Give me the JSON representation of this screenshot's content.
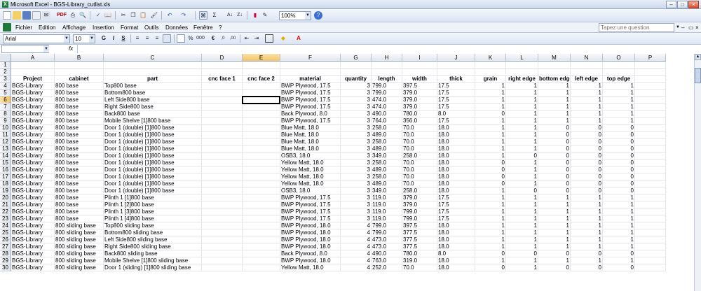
{
  "window": {
    "title": "Microsoft Excel - BGS-Library_cutlist.xls",
    "app_icon": "X"
  },
  "toolbar": {
    "zoom": "100%",
    "pdf_label": "PDF"
  },
  "menu": {
    "items": [
      "Fichier",
      "Edition",
      "Affichage",
      "Insertion",
      "Format",
      "Outils",
      "Données",
      "Fenêtre",
      "?"
    ],
    "help_placeholder": "Tapez une question"
  },
  "format_bar": {
    "font": "Arial",
    "size": "10",
    "bold": "G",
    "italic": "I",
    "underline": "S"
  },
  "formula_bar": {
    "name_box": "",
    "fx": "fx",
    "value": ""
  },
  "sheet": {
    "columns": [
      "A",
      "B",
      "C",
      "D",
      "E",
      "F",
      "G",
      "H",
      "I",
      "J",
      "K",
      "L",
      "M",
      "N",
      "O",
      "P"
    ],
    "selected_column": "E",
    "selected_row": "6",
    "headers": [
      "Project",
      "cabinet",
      "part",
      "cnc face 1",
      "cnc face 2",
      "material",
      "quantity",
      "length",
      "width",
      "thick",
      "grain",
      "right edge",
      "bottom edge",
      "left edge",
      "top edge",
      ""
    ],
    "rows": [
      [
        "BGS-Library",
        "800 base",
        "Top800 base",
        "",
        "",
        "BWP Plywood, 17.5",
        "3",
        "799.0",
        "397.5",
        "17.5",
        "1",
        "1",
        "1",
        "1",
        "1"
      ],
      [
        "BGS-Library",
        "800 base",
        "Bottom800 base",
        "",
        "",
        "BWP Plywood, 17.5",
        "3",
        "799.0",
        "379.0",
        "17.5",
        "1",
        "1",
        "1",
        "1",
        "1"
      ],
      [
        "BGS-Library",
        "800 base",
        "Left Side800 base",
        "",
        "",
        "BWP Plywood, 17.5",
        "3",
        "474.0",
        "379.0",
        "17.5",
        "1",
        "1",
        "1",
        "1",
        "1"
      ],
      [
        "BGS-Library",
        "800 base",
        "Right Side800 base",
        "",
        "",
        "BWP Plywood, 17.5",
        "3",
        "474.0",
        "379.0",
        "17.5",
        "1",
        "1",
        "1",
        "1",
        "1"
      ],
      [
        "BGS-Library",
        "800 base",
        "Back800 base",
        "",
        "",
        "Back Plywood, 8.0",
        "3",
        "490.0",
        "780.0",
        "8.0",
        "0",
        "1",
        "1",
        "1",
        "1"
      ],
      [
        "BGS-Library",
        "800 base",
        "Mobile Shelve [1]800 base",
        "",
        "",
        "BWP Plywood, 17.5",
        "3",
        "764.0",
        "356.0",
        "17.5",
        "1",
        "1",
        "1",
        "1",
        "1"
      ],
      [
        "BGS-Library",
        "800 base",
        "Door 1 (double) [1]800 base",
        "",
        "",
        "Blue Matt, 18.0",
        "3",
        "258.0",
        "70.0",
        "18.0",
        "1",
        "1",
        "0",
        "0",
        "0"
      ],
      [
        "BGS-Library",
        "800 base",
        "Door 1 (double) [1]800 base",
        "",
        "",
        "Blue Matt, 18.0",
        "3",
        "489.0",
        "70.0",
        "18.0",
        "1",
        "1",
        "0",
        "0",
        "0"
      ],
      [
        "BGS-Library",
        "800 base",
        "Door 1 (double) [1]800 base",
        "",
        "",
        "Blue Matt, 18.0",
        "3",
        "258.0",
        "70.0",
        "18.0",
        "1",
        "1",
        "0",
        "0",
        "0"
      ],
      [
        "BGS-Library",
        "800 base",
        "Door 1 (double) [1]800 base",
        "",
        "",
        "Blue Matt, 18.0",
        "3",
        "489.0",
        "70.0",
        "18.0",
        "1",
        "1",
        "0",
        "0",
        "0"
      ],
      [
        "BGS-Library",
        "800 base",
        "Door 1 (double) [1]800 base",
        "",
        "",
        "OSB3, 18.0",
        "3",
        "349.0",
        "258.0",
        "18.0",
        "1",
        "0",
        "0",
        "0",
        "0"
      ],
      [
        "BGS-Library",
        "800 base",
        "Door 1 (double) [1]800 base",
        "",
        "",
        "Yellow Matt, 18.0",
        "3",
        "258.0",
        "70.0",
        "18.0",
        "0",
        "1",
        "0",
        "0",
        "0"
      ],
      [
        "BGS-Library",
        "800 base",
        "Door 1 (double) [1]800 base",
        "",
        "",
        "Yellow Matt, 18.0",
        "3",
        "489.0",
        "70.0",
        "18.0",
        "0",
        "1",
        "0",
        "0",
        "0"
      ],
      [
        "BGS-Library",
        "800 base",
        "Door 1 (double) [1]800 base",
        "",
        "",
        "Yellow Matt, 18.0",
        "3",
        "258.0",
        "70.0",
        "18.0",
        "0",
        "1",
        "0",
        "0",
        "0"
      ],
      [
        "BGS-Library",
        "800 base",
        "Door 1 (double) [1]800 base",
        "",
        "",
        "Yellow Matt, 18.0",
        "3",
        "489.0",
        "70.0",
        "18.0",
        "0",
        "1",
        "0",
        "0",
        "0"
      ],
      [
        "BGS-Library",
        "800 base",
        "Door 1 (double) [1]800 base",
        "",
        "",
        "OSB3, 18.0",
        "3",
        "349.0",
        "258.0",
        "18.0",
        "1",
        "0",
        "0",
        "0",
        "0"
      ],
      [
        "BGS-Library",
        "800 base",
        "Plinth 1 [1]800 base",
        "",
        "",
        "BWP Plywood, 17.5",
        "3",
        "119.0",
        "379.0",
        "17.5",
        "1",
        "1",
        "1",
        "1",
        "1"
      ],
      [
        "BGS-Library",
        "800 base",
        "Plinth 1 [2]800 base",
        "",
        "",
        "BWP Plywood, 17.5",
        "3",
        "119.0",
        "379.0",
        "17.5",
        "1",
        "1",
        "1",
        "1",
        "1"
      ],
      [
        "BGS-Library",
        "800 base",
        "Plinth 1 [3]800 base",
        "",
        "",
        "BWP Plywood, 17.5",
        "3",
        "119.0",
        "799.0",
        "17.5",
        "1",
        "1",
        "1",
        "1",
        "1"
      ],
      [
        "BGS-Library",
        "800 base",
        "Plinth 1 [4]800 base",
        "",
        "",
        "BWP Plywood, 17.5",
        "3",
        "119.0",
        "799.0",
        "17.5",
        "1",
        "1",
        "1",
        "1",
        "1"
      ],
      [
        "BGS-Library",
        "800 sliding base",
        "Top800 sliding base",
        "",
        "",
        "BWP Plywood, 18.0",
        "4",
        "799.0",
        "397.5",
        "18.0",
        "1",
        "1",
        "1",
        "1",
        "1"
      ],
      [
        "BGS-Library",
        "800 sliding base",
        "Bottom800 sliding base",
        "",
        "",
        "BWP Plywood, 18.0",
        "4",
        "799.0",
        "377.5",
        "18.0",
        "1",
        "1",
        "1",
        "1",
        "1"
      ],
      [
        "BGS-Library",
        "800 sliding base",
        "Left Side800 sliding base",
        "",
        "",
        "BWP Plywood, 18.0",
        "4",
        "473.0",
        "377.5",
        "18.0",
        "1",
        "1",
        "1",
        "1",
        "1"
      ],
      [
        "BGS-Library",
        "800 sliding base",
        "Right Side800 sliding base",
        "",
        "",
        "BWP Plywood, 18.0",
        "4",
        "473.0",
        "377.5",
        "18.0",
        "1",
        "1",
        "1",
        "1",
        "1"
      ],
      [
        "BGS-Library",
        "800 sliding base",
        "Back800 sliding base",
        "",
        "",
        "Back Plywood, 8.0",
        "4",
        "490.0",
        "780.0",
        "8.0",
        "0",
        "0",
        "0",
        "0",
        "0"
      ],
      [
        "BGS-Library",
        "800 sliding base",
        "Mobile Shelve [1]800 sliding base",
        "",
        "",
        "BWP Plywood, 18.0",
        "4",
        "763.0",
        "319.0",
        "18.0",
        "1",
        "1",
        "1",
        "1",
        "1"
      ],
      [
        "BGS-Library",
        "800 sliding base",
        "Door 1 (sliding) [1]800 sliding base",
        "",
        "",
        "Yellow Matt, 18.0",
        "4",
        "252.0",
        "70.0",
        "18.0",
        "0",
        "1",
        "0",
        "0",
        "0"
      ]
    ]
  }
}
